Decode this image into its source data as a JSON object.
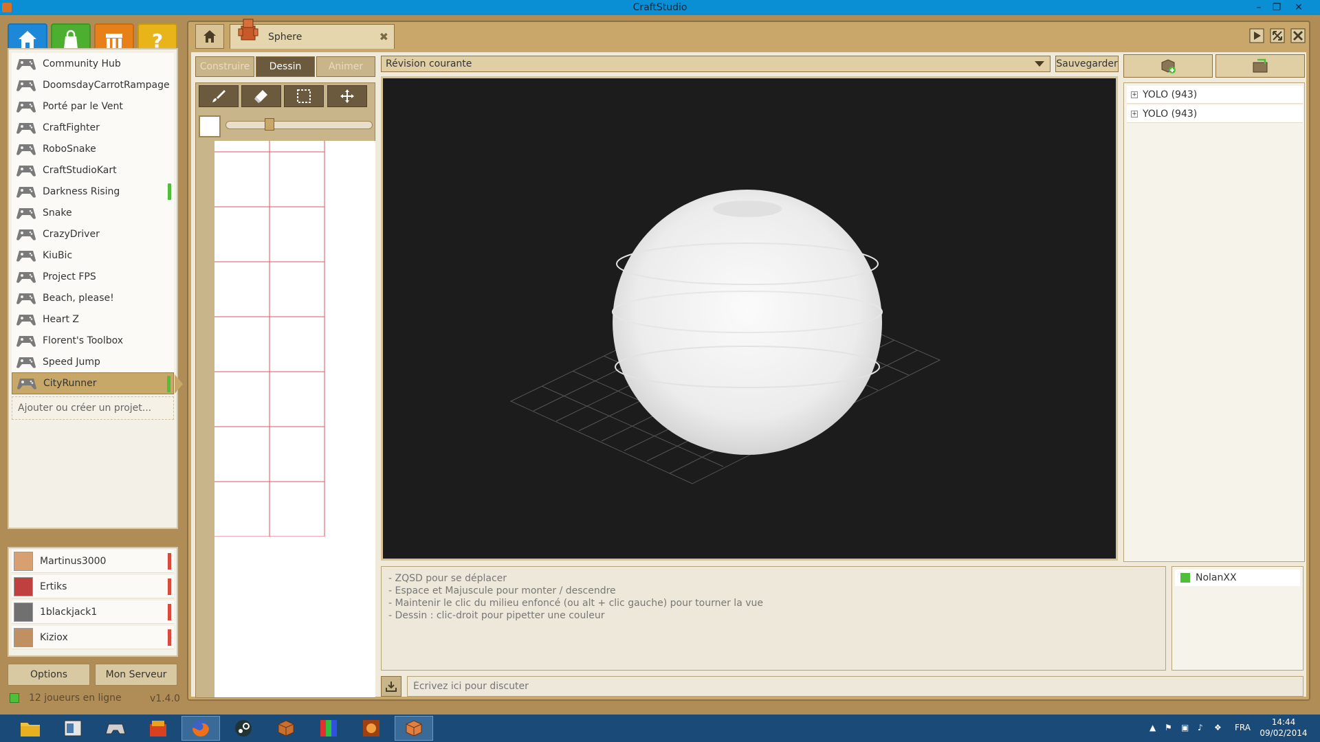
{
  "window": {
    "title": "CraftStudio"
  },
  "nav": {
    "home_color": "#1e88d8",
    "store_color": "#4caf2f",
    "community_color": "#e8801a",
    "help_color": "#e8b41a"
  },
  "projects": [
    "Community Hub",
    "DoomsdayCarrotRampage",
    "Porté par le Vent",
    "CraftFighter",
    "RoboSnake",
    "CraftStudioKart",
    "Darkness Rising",
    "Snake",
    "CrazyDriver",
    "KiuBic",
    "Project FPS",
    "Beach, please!",
    "Heart Z",
    "Florent's Toolbox",
    "Speed Jump",
    "CityRunner"
  ],
  "add_project_label": "Ajouter ou créer un projet...",
  "users": [
    "Martinus3000",
    "Ertiks",
    "1blackjack1",
    "Kiziox"
  ],
  "footer": {
    "options_label": "Options",
    "server_label": "Mon Serveur",
    "online_text": "12 joueurs en ligne",
    "version": "v1.4.0"
  },
  "tab": {
    "label": "Sphere"
  },
  "modes": {
    "build": "Construire",
    "paint": "Dessin",
    "animate": "Animer"
  },
  "revision": {
    "selected": "Révision courante",
    "save_label": "Sauvegarder"
  },
  "revisions": [
    "YOLO (943)",
    "YOLO (943)"
  ],
  "help_lines": [
    "- ZQSD pour se déplacer",
    "- Espace et Majuscule pour monter / descendre",
    "- Maintenir le clic du milieu enfoncé (ou alt + clic gauche) pour tourner la vue",
    "- Dessin : clic-droit pour pipetter une couleur"
  ],
  "chat": {
    "placeholder": "Écrivez ici pour discuter",
    "online_user": "NolanXX"
  },
  "taskbar": {
    "lang": "FRA",
    "time": "14:44",
    "date": "09/02/2014"
  }
}
